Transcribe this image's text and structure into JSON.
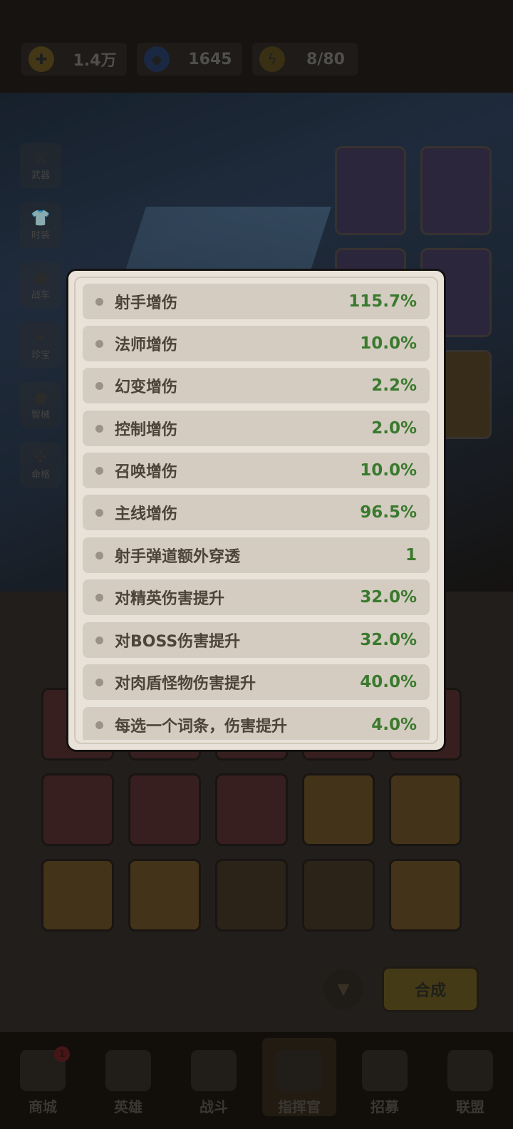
{
  "resources": [
    {
      "icon": "coin-icon",
      "value": "1.4万"
    },
    {
      "icon": "diamond-icon",
      "value": "1645"
    },
    {
      "icon": "energy-icon",
      "value": "8/80"
    }
  ],
  "side_menu": [
    {
      "icon": "weapon-icon",
      "label": "武器"
    },
    {
      "icon": "fashion-icon",
      "label": "时装"
    },
    {
      "icon": "vehicle-icon",
      "label": "战车"
    },
    {
      "icon": "treasure-icon",
      "label": "珍宝"
    },
    {
      "icon": "mecha-icon",
      "label": "智械"
    },
    {
      "icon": "circuit-icon",
      "label": "命格"
    }
  ],
  "synth_button": "合成",
  "navbar": [
    {
      "icon": "shop-icon",
      "label": "商城",
      "badge": "1"
    },
    {
      "icon": "hero-icon",
      "label": "英雄"
    },
    {
      "icon": "battle-icon",
      "label": "战斗"
    },
    {
      "icon": "commander-icon",
      "label": "指挥官",
      "active": true
    },
    {
      "icon": "recruit-icon",
      "label": "招募"
    },
    {
      "icon": "alliance-icon",
      "label": "联盟"
    }
  ],
  "stats": [
    {
      "label": "射手增伤",
      "value": "115.7%"
    },
    {
      "label": "法师增伤",
      "value": "10.0%"
    },
    {
      "label": "幻变增伤",
      "value": "2.2%"
    },
    {
      "label": "控制增伤",
      "value": "2.0%"
    },
    {
      "label": "召唤增伤",
      "value": "10.0%"
    },
    {
      "label": "主线增伤",
      "value": "96.5%"
    },
    {
      "label": "射手弹道额外穿透",
      "value": "1"
    },
    {
      "label": "对精英伤害提升",
      "value": "32.0%"
    },
    {
      "label": "对BOSS伤害提升",
      "value": "32.0%"
    },
    {
      "label": "对肉盾怪物伤害提升",
      "value": "40.0%"
    },
    {
      "label": "每选一个词条，伤害提升",
      "value": "4.0%"
    }
  ]
}
